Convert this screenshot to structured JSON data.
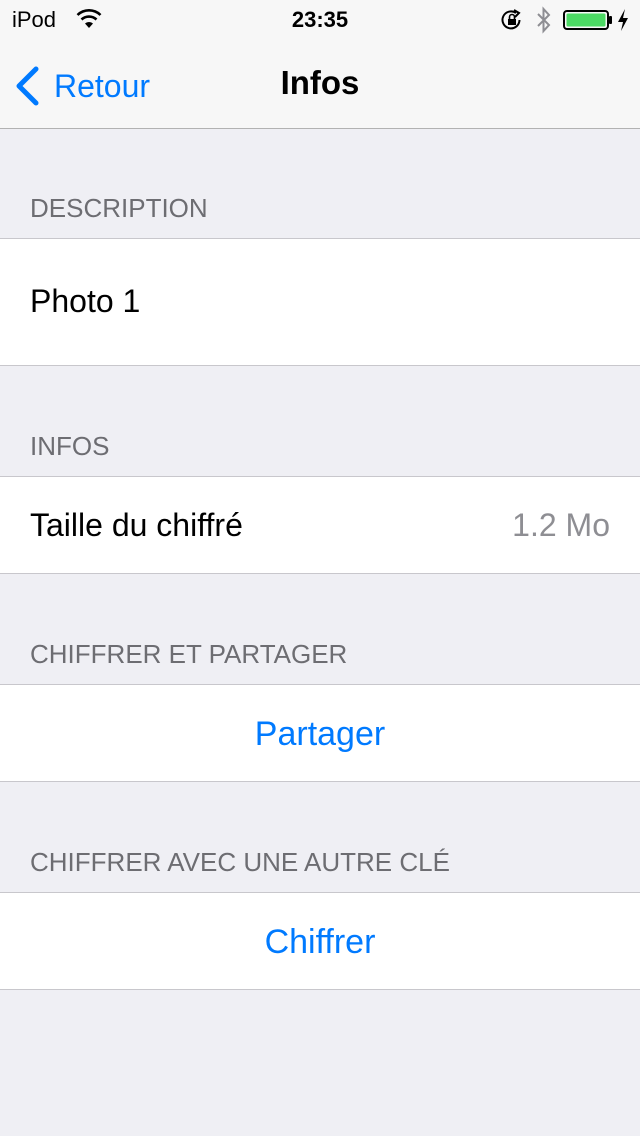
{
  "status_bar": {
    "carrier": "iPod",
    "time": "23:35"
  },
  "nav": {
    "back_label": "Retour",
    "title": "Infos"
  },
  "sections": {
    "description": {
      "header": "DESCRIPTION",
      "value": "Photo 1"
    },
    "infos": {
      "header": "INFOS",
      "row_label": "Taille du chiffré",
      "row_value": "1.2 Mo"
    },
    "share": {
      "header": "CHIFFRER ET PARTAGER",
      "action_label": "Partager"
    },
    "encrypt": {
      "header": "CHIFFRER AVEC UNE AUTRE CLÉ",
      "action_label": "Chiffrer"
    }
  },
  "colors": {
    "accent": "#007aff",
    "background": "#efeff4",
    "header_text": "#6d6d72",
    "battery": "#4cd964"
  },
  "battery_level": 1.0
}
